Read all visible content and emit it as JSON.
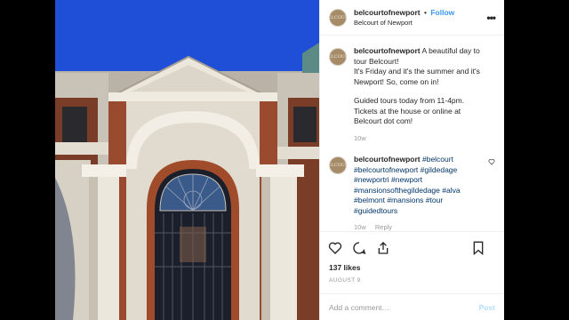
{
  "header": {
    "username": "belcourtofnewport",
    "follow_label": "Follow",
    "location": "Belcourt of Newport",
    "separator": "•"
  },
  "caption": {
    "username": "belcourtofnewport",
    "text_line1": "A beautiful day to tour Belcourt!",
    "text_line2": "It's Friday and it's the summer and it's Newport! So, come on in!",
    "text_line3": "Guided tours today from 11-4pm. Tickets at the house or online at Belcourt dot com!",
    "time": "10w"
  },
  "comment": {
    "username": "belcourtofnewport",
    "hashtags": "#belcourt #belcourtofnewport #gildedage #newportri #newport #mansionsofthegildedage #alva #belmont #mansions #tour #guidedtours",
    "time": "10w",
    "reply_label": "Reply"
  },
  "likes": "137 likes",
  "date": "AUGUST 9",
  "add_comment": {
    "placeholder": "Add a comment…",
    "post_label": "Post"
  },
  "colors": {
    "link": "#3897f0",
    "hashtag": "#003569",
    "sky": "#1f4fd6"
  },
  "icons": [
    "more-options-icon",
    "heart-icon",
    "comment-icon",
    "share-icon",
    "bookmark-icon"
  ]
}
